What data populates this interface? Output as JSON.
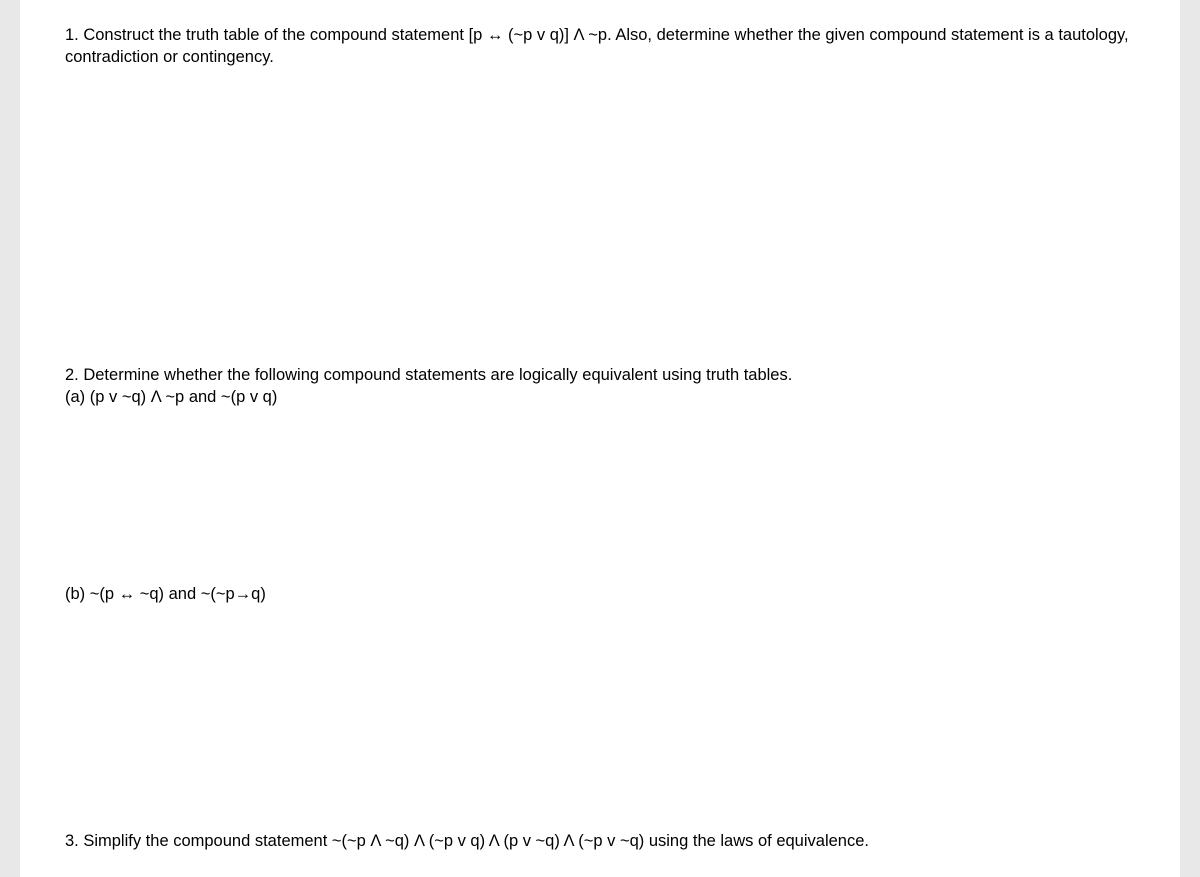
{
  "questions": {
    "q1": "1. Construct the truth table of the compound statement [p ↔ (~p v q)] Λ ~p. Also, determine whether the given compound statement is a tautology, contradiction or contingency.",
    "q2_intro": "2. Determine whether the following compound statements are logically equivalent using truth tables.",
    "q2a": "(a) (p v ~q) Λ ~p and ~(p v q)",
    "q2b": "(b) ~(p ↔ ~q) and ~(~p→q)",
    "q3": "3. Simplify the compound statement ~(~p Λ ~q) Λ (~p v q) Λ (p v ~q) Λ (~p v ~q) using the laws of equivalence."
  }
}
